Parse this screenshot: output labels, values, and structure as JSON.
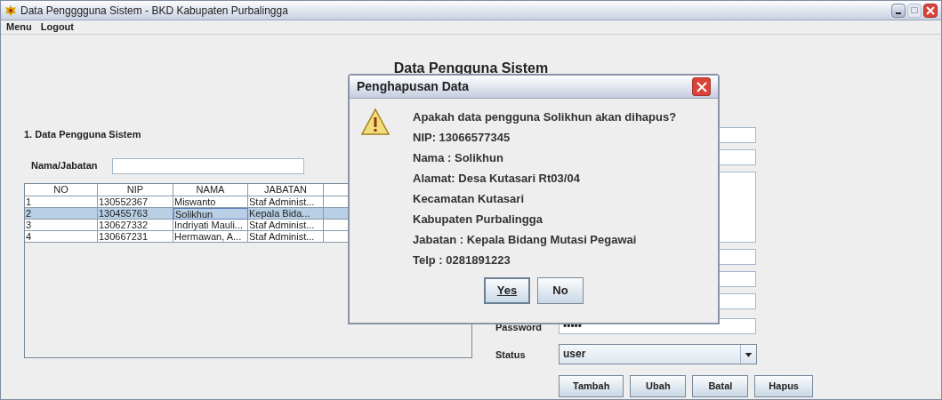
{
  "window": {
    "title": "Data Pengggguna Sistem - BKD Kabupaten Purbalingga"
  },
  "menu": [
    "Menu",
    "Logout"
  ],
  "heading": "Data Pengguna Sistem",
  "section": {
    "title": "1. Data Pengguna Sistem",
    "search_label": "Nama/Jabatan"
  },
  "table": {
    "columns": [
      "NO",
      "NIP",
      "NAMA",
      "JABATAN"
    ],
    "rows": [
      {
        "cells": [
          "1",
          "130552367",
          "Miswanto",
          "Staf Administ..."
        ],
        "selected": false
      },
      {
        "cells": [
          "2",
          "130455763",
          "Solikhun",
          "Kepala Bida..."
        ],
        "selected": true
      },
      {
        "cells": [
          "3",
          "130627332",
          "Indriyati Mauli...",
          "Staf Administ..."
        ],
        "selected": false
      },
      {
        "cells": [
          "4",
          "130667231",
          "Hermawan, A...",
          "Staf Administ..."
        ],
        "selected": false
      }
    ]
  },
  "form": {
    "fields": [
      {
        "kind": "text"
      },
      {
        "kind": "text"
      },
      {
        "kind": "textarea"
      },
      {
        "kind": "text"
      },
      {
        "kind": "text"
      },
      {
        "kind": "text"
      },
      {
        "kind": "password",
        "label": "Password",
        "value": "•••••"
      },
      {
        "kind": "select",
        "label": "Status",
        "value": "user"
      }
    ],
    "buttons": [
      "Tambah",
      "Ubah",
      "Batal",
      "Hapus"
    ]
  },
  "dialog": {
    "title": "Penghapusan Data",
    "lines": [
      "Apakah data pengguna Solikhun akan dihapus?",
      "NIP: 13066577345",
      "Nama : Solikhun",
      "Alamat: Desa Kutasari Rt03/04",
      "Kecamatan Kutasari",
      "Kabupaten Purbalingga",
      "Jabatan : Kepala Bidang Mutasi Pegawai",
      "Telp : 0281891223"
    ],
    "buttons": [
      {
        "label": "Yes",
        "selected": true
      },
      {
        "label": "No",
        "selected": false
      }
    ]
  }
}
